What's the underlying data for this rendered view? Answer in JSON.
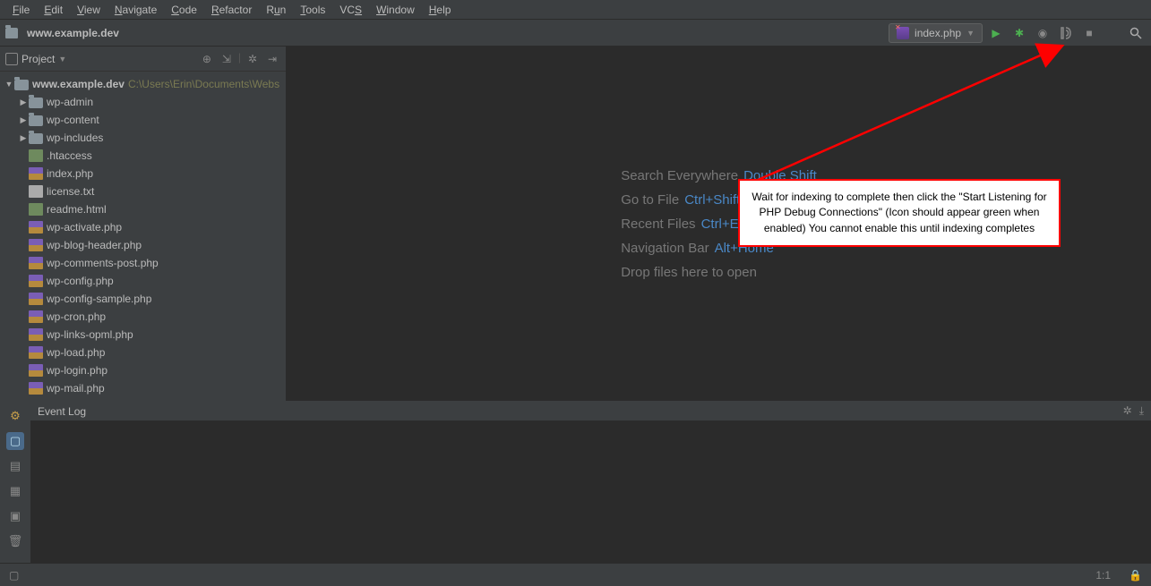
{
  "menu": {
    "items": [
      {
        "pre": "",
        "mn": "F",
        "post": "ile"
      },
      {
        "pre": "",
        "mn": "E",
        "post": "dit"
      },
      {
        "pre": "",
        "mn": "V",
        "post": "iew"
      },
      {
        "pre": "",
        "mn": "N",
        "post": "avigate"
      },
      {
        "pre": "",
        "mn": "C",
        "post": "ode"
      },
      {
        "pre": "",
        "mn": "R",
        "post": "efactor"
      },
      {
        "pre": "R",
        "mn": "u",
        "post": "n"
      },
      {
        "pre": "",
        "mn": "T",
        "post": "ools"
      },
      {
        "pre": "VC",
        "mn": "S",
        "post": ""
      },
      {
        "pre": "",
        "mn": "W",
        "post": "indow"
      },
      {
        "pre": "",
        "mn": "H",
        "post": "elp"
      }
    ]
  },
  "breadcrumb": {
    "project": "www.example.dev"
  },
  "run_config": {
    "label": "index.php"
  },
  "project_panel": {
    "title": "Project"
  },
  "tree": {
    "root": {
      "name": "www.example.dev",
      "path": "C:\\Users\\Erin\\Documents\\Webs"
    },
    "folders": [
      {
        "name": "wp-admin"
      },
      {
        "name": "wp-content"
      },
      {
        "name": "wp-includes"
      }
    ],
    "files": [
      {
        "name": ".htaccess",
        "icon": "file"
      },
      {
        "name": "index.php",
        "icon": "php"
      },
      {
        "name": "license.txt",
        "icon": "txt"
      },
      {
        "name": "readme.html",
        "icon": "file"
      },
      {
        "name": "wp-activate.php",
        "icon": "php"
      },
      {
        "name": "wp-blog-header.php",
        "icon": "php"
      },
      {
        "name": "wp-comments-post.php",
        "icon": "php"
      },
      {
        "name": "wp-config.php",
        "icon": "php"
      },
      {
        "name": "wp-config-sample.php",
        "icon": "php"
      },
      {
        "name": "wp-cron.php",
        "icon": "php"
      },
      {
        "name": "wp-links-opml.php",
        "icon": "php"
      },
      {
        "name": "wp-load.php",
        "icon": "php"
      },
      {
        "name": "wp-login.php",
        "icon": "php"
      },
      {
        "name": "wp-mail.php",
        "icon": "php"
      }
    ]
  },
  "welcome": {
    "rows": [
      {
        "label": "Search Everywhere",
        "key": "Double Shift"
      },
      {
        "label": "Go to File",
        "key": "Ctrl+Shift+N"
      },
      {
        "label": "Recent Files",
        "key": "Ctrl+E"
      },
      {
        "label": "Navigation Bar",
        "key": "Alt+Home"
      },
      {
        "label": "Drop files here to open",
        "key": ""
      }
    ]
  },
  "callout": {
    "text": "Wait for indexing to complete then click the \"Start Listening for PHP Debug Connections\" (Icon should appear green when enabled) You cannot enable this until indexing completes"
  },
  "event_log": {
    "title": "Event Log"
  },
  "status": {
    "pos": "1:1",
    "lock": "🔒"
  }
}
